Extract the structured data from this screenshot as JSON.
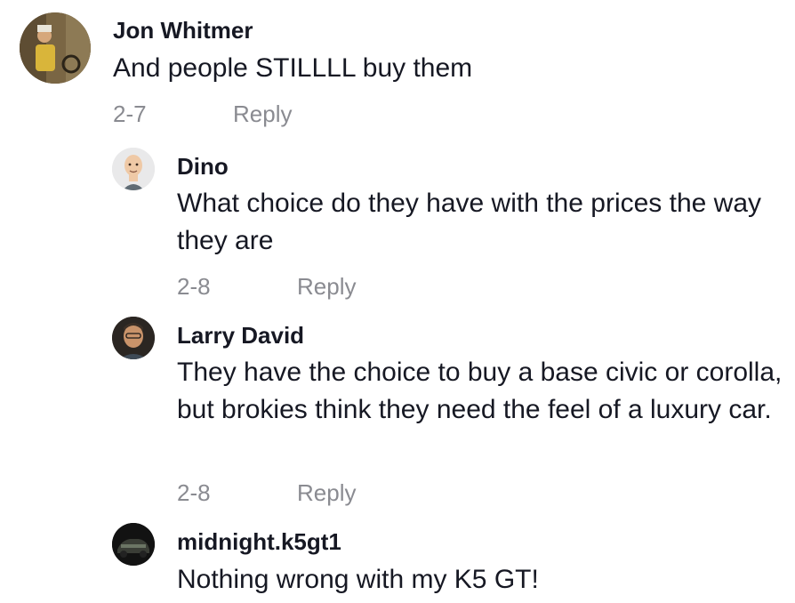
{
  "comments": [
    {
      "username": "Jon Whitmer",
      "text": "And people STILLLL buy them",
      "date": "2-7",
      "reply_label": "Reply",
      "avatar": "photo-avatar-yellow-shirt"
    },
    {
      "username": "Dino",
      "text": "What choice do they have with the prices the way they are",
      "date": "2-8",
      "reply_label": "Reply",
      "avatar": "memoji-avatar-bald"
    },
    {
      "username": "Larry David",
      "text": "They have the choice to buy a base civic or corolla, but brokies think they need the feel of a luxury car.",
      "date": "2-8",
      "reply_label": "Reply",
      "avatar": "photo-avatar-dark"
    },
    {
      "username": "midnight.k5gt1",
      "text": "Nothing wrong with my K5 GT!",
      "avatar": "car-avatar-dark"
    }
  ],
  "colors": {
    "text": "#161823",
    "meta": "#8a8b91"
  }
}
